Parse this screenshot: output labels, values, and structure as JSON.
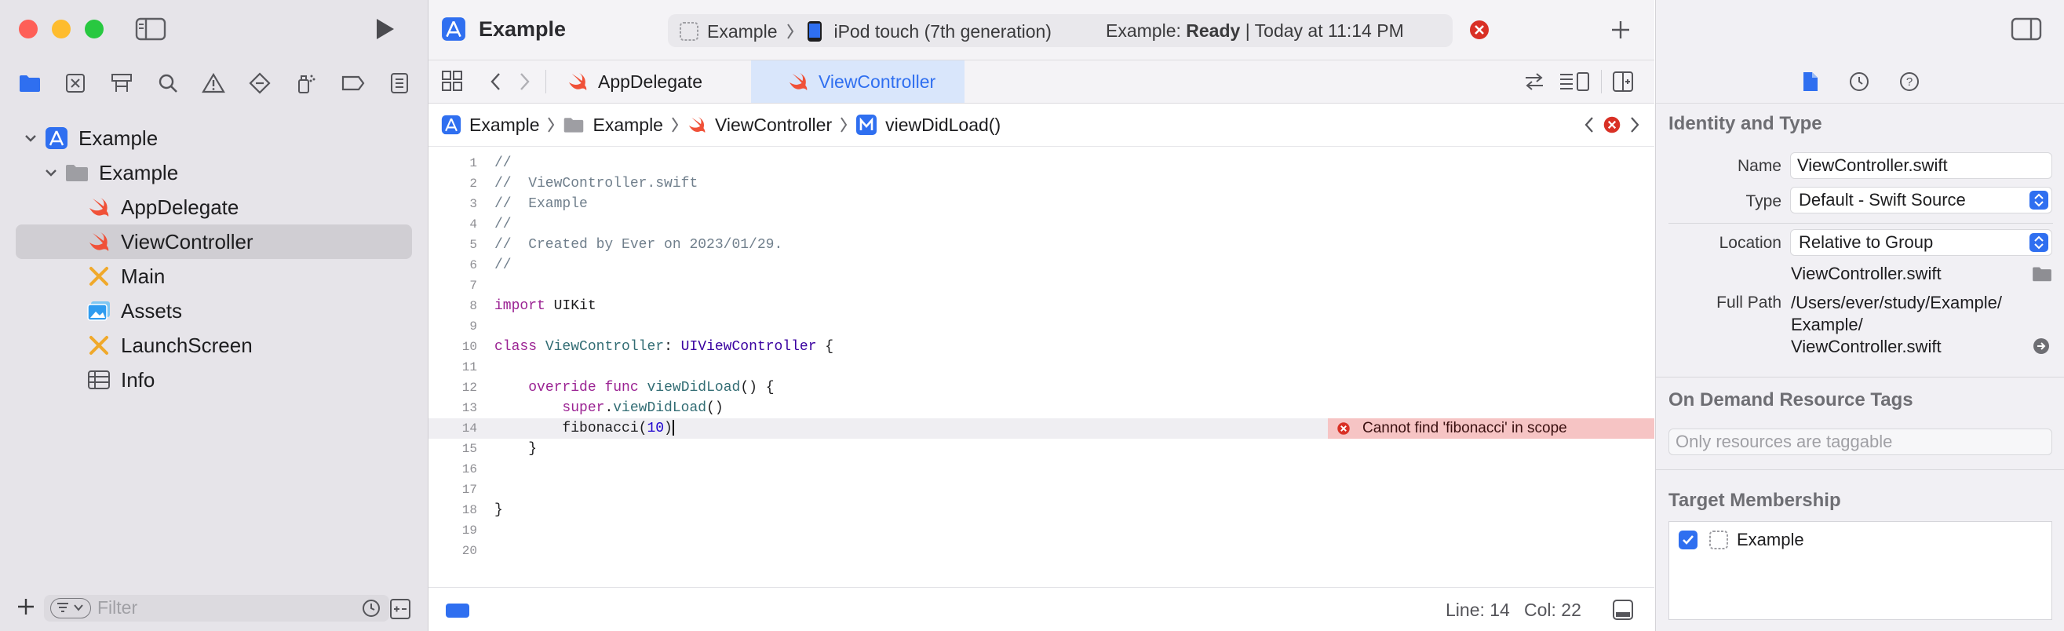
{
  "toolbar": {
    "project_title": "Example",
    "scheme": "Example",
    "device": "iPod touch (7th generation)",
    "status_prefix": "Example: ",
    "status_state": "Ready",
    "status_time": " | Today at 11:14 PM"
  },
  "navigator": {
    "tree": [
      {
        "label": "Example",
        "kind": "project",
        "level": 0
      },
      {
        "label": "Example",
        "kind": "folder",
        "level": 1
      },
      {
        "label": "AppDelegate",
        "kind": "swift",
        "level": 2
      },
      {
        "label": "ViewController",
        "kind": "swift",
        "level": 2,
        "selected": true
      },
      {
        "label": "Main",
        "kind": "storyboard",
        "level": 2
      },
      {
        "label": "Assets",
        "kind": "assets",
        "level": 2
      },
      {
        "label": "LaunchScreen",
        "kind": "storyboard",
        "level": 2
      },
      {
        "label": "Info",
        "kind": "plist",
        "level": 2
      }
    ],
    "filter_placeholder": "Filter"
  },
  "tabs": [
    {
      "label": "AppDelegate",
      "active": false
    },
    {
      "label": "ViewController",
      "active": true
    }
  ],
  "jumpbar": [
    "Example",
    "Example",
    "ViewController",
    "viewDidLoad()"
  ],
  "editor": {
    "lines": [
      "//",
      "//  ViewController.swift",
      "//  Example",
      "//",
      "//  Created by Ever on 2023/01/29.",
      "//",
      "",
      "import UIKit",
      "",
      "class ViewController: UIViewController {",
      "",
      "    override func viewDidLoad() {",
      "        super.viewDidLoad()",
      "        fibonacci(10)",
      "    }",
      "",
      "",
      "}",
      "",
      ""
    ],
    "line_numbers": [
      "1",
      "2",
      "3",
      "4",
      "5",
      "6",
      "7",
      "8",
      "9",
      "10",
      "11",
      "12",
      "13",
      "14",
      "15",
      "16",
      "17",
      "18",
      "19",
      "20"
    ],
    "current_line": 14,
    "error_message": "Cannot find 'fibonacci' in scope"
  },
  "status": {
    "line": "Line: 14",
    "col": "Col: 22"
  },
  "inspector": {
    "identity_title": "Identity and Type",
    "name_label": "Name",
    "name_value": "ViewController.swift",
    "type_label": "Type",
    "type_value": "Default - Swift Source",
    "location_label": "Location",
    "location_value": "Relative to Group",
    "location_file": "ViewController.swift",
    "fullpath_label": "Full Path",
    "fullpath_value": [
      "/Users/ever/study/Example/",
      "Example/",
      "ViewController.swift"
    ],
    "odr_title": "On Demand Resource Tags",
    "odr_placeholder": "Only resources are taggable",
    "target_title": "Target Membership",
    "target_name": "Example",
    "target_checked": true
  },
  "colors": {
    "accent": "#2f6ff0",
    "error": "#d93025",
    "swift": "#f05138",
    "selection": "#d0ced3"
  }
}
